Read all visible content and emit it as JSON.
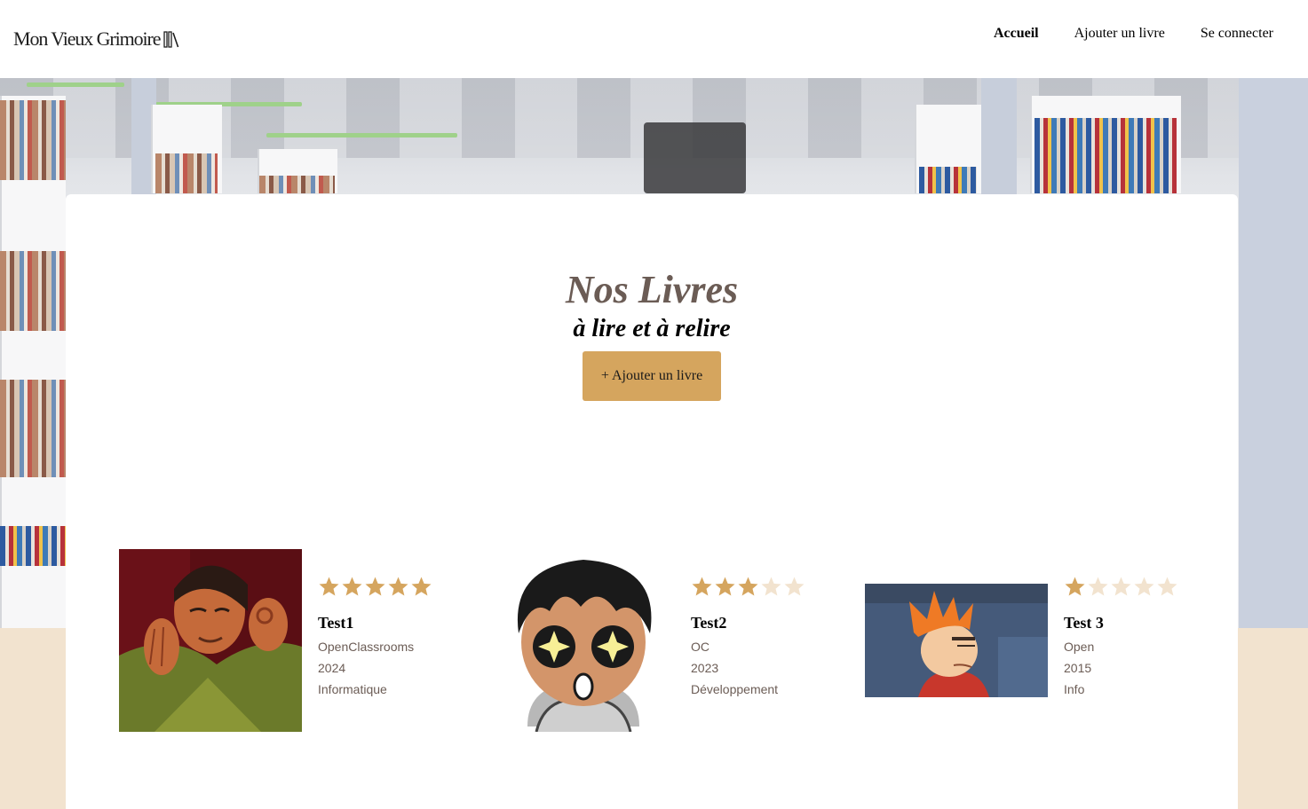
{
  "header": {
    "logo_text": "Mon Vieux Grimoire",
    "nav": [
      {
        "label": "Accueil",
        "active": true
      },
      {
        "label": "Ajouter un livre",
        "active": false
      },
      {
        "label": "Se connecter",
        "active": false
      }
    ]
  },
  "hero": {
    "title": "Nos Livres",
    "subtitle": "à lire et à relire",
    "add_button_label": "+ Ajouter un livre"
  },
  "colors": {
    "accent": "#d5a55e",
    "star_filled": "#d5a55e",
    "star_empty": "#f2e3cf",
    "title_brown": "#6b5c55",
    "beige_background": "#f2e3cf"
  },
  "books": [
    {
      "title": "Test1",
      "author": "OpenClassrooms",
      "year": "2024",
      "genre": "Informatique",
      "rating": 5,
      "cover_icon": "meme-kronk-ok-hand-image"
    },
    {
      "title": "Test2",
      "author": "OC",
      "year": "2023",
      "genre": "Développement",
      "rating": 3,
      "cover_icon": "cartoon-starry-eyes-image"
    },
    {
      "title": "Test 3",
      "author": "Open",
      "year": "2015",
      "genre": "Info",
      "rating": 1,
      "cover_icon": "meme-fry-squinting-image"
    }
  ]
}
